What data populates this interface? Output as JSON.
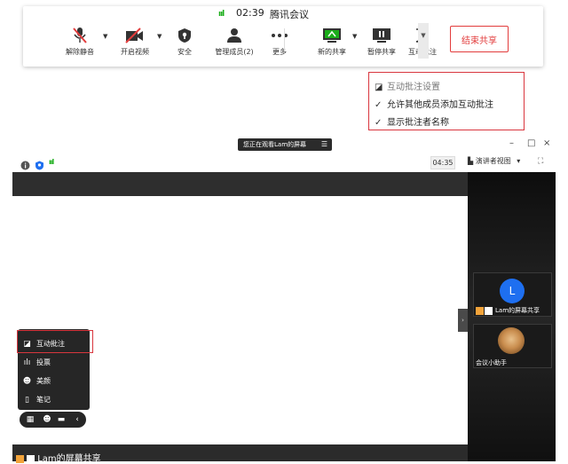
{
  "meeting_bar": {
    "signal_glyph": "ııl",
    "time": "02:39",
    "title": "腾讯会议",
    "buttons": [
      {
        "label": "解除静音",
        "icon": "mic-muted-icon"
      },
      {
        "label": "开启视频",
        "icon": "video-off-icon"
      },
      {
        "label": "安全",
        "icon": "shield-icon"
      },
      {
        "label": "管理成员(2)",
        "icon": "members-icon"
      },
      {
        "label": "更多",
        "icon": "more-dots-icon"
      },
      {
        "label": "新的共享",
        "icon": "new-share-icon"
      },
      {
        "label": "暂停共享",
        "icon": "pause-share-icon"
      },
      {
        "label": "互动批注",
        "icon": "annotate-icon"
      }
    ],
    "end_share_label": "结束共享",
    "accent_red": "#e23c3c",
    "accent_green": "#1aad19"
  },
  "annotation_menu": {
    "items": [
      {
        "label": "互动批注设置",
        "checked": false
      },
      {
        "label": "允许其他成员添加互动批注",
        "checked": true
      },
      {
        "label": "显示批注者名称",
        "checked": true
      }
    ],
    "check_glyph": "✓"
  },
  "share_window": {
    "watching_text": "您正在观看Lam的屏幕",
    "menu_glyph": "☰",
    "controls": {
      "minimize": "–",
      "maximize": "□",
      "close": "×"
    },
    "timer": "04:35",
    "view_mode": "演讲者视图",
    "view_caret": "▾",
    "fullscreen_glyph": "⛶",
    "bottom_label": "Lam的屏幕共享",
    "collapse_glyph": "›"
  },
  "participants": [
    {
      "initial": "L",
      "name": "Lam的屏幕共享",
      "avatar_color": "#1e6ff0"
    },
    {
      "initial": "",
      "name": "会议小助手"
    }
  ],
  "floating_toolbar": {
    "items": [
      {
        "label": "互动批注",
        "icon": "annotate-icon",
        "glyph": "◪"
      },
      {
        "label": "投票",
        "icon": "poll-icon",
        "glyph": "ılı"
      },
      {
        "label": "美颜",
        "icon": "beauty-icon",
        "glyph": "☻"
      },
      {
        "label": "笔记",
        "icon": "notes-icon",
        "glyph": "▯"
      }
    ],
    "bar_icons": [
      "apps-icon",
      "emoji-icon",
      "chat-icon",
      "collapse-icon"
    ],
    "bar_glyphs": [
      "▦",
      "☻",
      "▬",
      "‹"
    ]
  }
}
